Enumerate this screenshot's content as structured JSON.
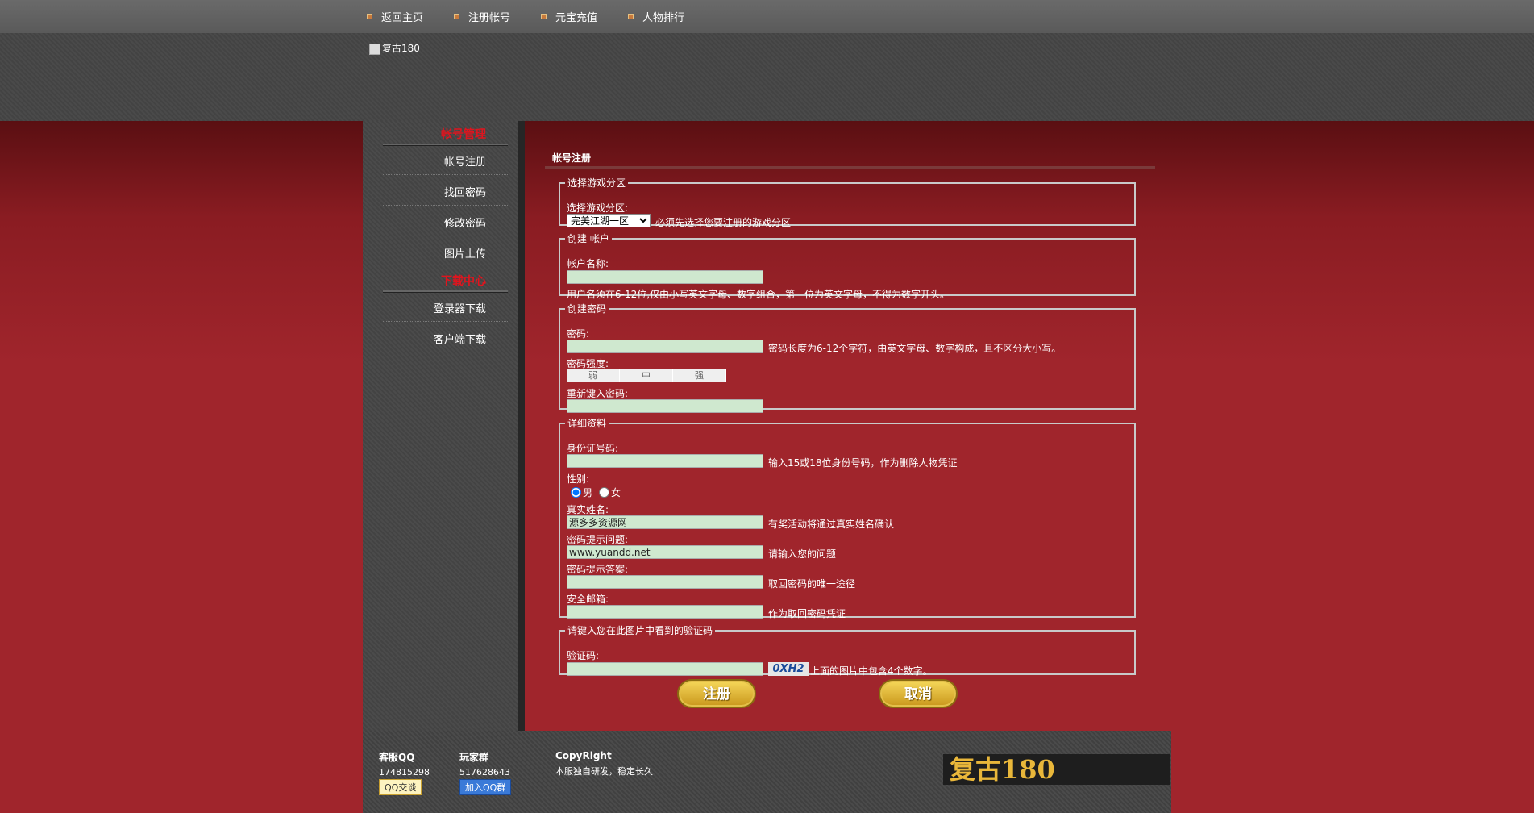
{
  "nav": [
    "返回主页",
    "注册帐号",
    "元宝充值",
    "人物排行"
  ],
  "logo_alt": "复古180",
  "sidebar": {
    "section1": "帐号管理",
    "section1_items": [
      "帐号注册",
      "找回密码",
      "修改密码",
      "图片上传"
    ],
    "section2": "下载中心",
    "section2_items": [
      "登录器下载",
      "客户端下载"
    ]
  },
  "content": {
    "title": "帐号注册",
    "zone": {
      "legend": "选择游戏分区",
      "label": "选择游戏分区:",
      "selected": "完美江湖一区",
      "hint": "必须先选择您要注册的游戏分区"
    },
    "account": {
      "legend": "创建 帐户",
      "label": "帐户名称:",
      "hint": "用户名须在6-12位,仅由小写英文字母、数字组合，第一位为英文字母，不得为数字开头。"
    },
    "password": {
      "legend": "创建密码",
      "label": "密码:",
      "hint": "密码长度为6-12个字符，由英文字母、数字构成，且不区分大小写。",
      "strength_label": "密码强度:",
      "strength": [
        "弱",
        "中",
        "强"
      ],
      "confirm_label": "重新键入密码:"
    },
    "details": {
      "legend": "详细资料",
      "id_label": "身份证号码:",
      "id_hint": "输入15或18位身份号码，作为删除人物凭证",
      "gender_label": "性别:",
      "male": "男",
      "female": "女",
      "name_label": "真实姓名:",
      "name_value": "源多多资源网",
      "name_hint": "有奖活动将通过真实姓名确认",
      "question_label": "密码提示问题:",
      "question_value": "www.yuandd.net",
      "question_hint": "请输入您的问题",
      "answer_label": "密码提示答案:",
      "answer_hint": "取回密码的唯一途径",
      "email_label": "安全邮箱:",
      "email_hint": "作为取回密码凭证"
    },
    "captcha": {
      "legend": "请键入您在此图片中看到的验证码",
      "label": "验证码:",
      "image_text": "0XH2",
      "hint": "上面的图片中包含4个数字。"
    },
    "submit": "注册",
    "cancel": "取消"
  },
  "footer": {
    "kefu_title": "客服QQ",
    "kefu_number": "174815298",
    "kefu_btn": "QQ交谈",
    "group_title": "玩家群",
    "group_number": "517628643",
    "group_btn": "加入QQ群",
    "copy_title": "CopyRight",
    "copy_text": "本服独自研发，稳定长久",
    "logo_text": "复古180"
  }
}
